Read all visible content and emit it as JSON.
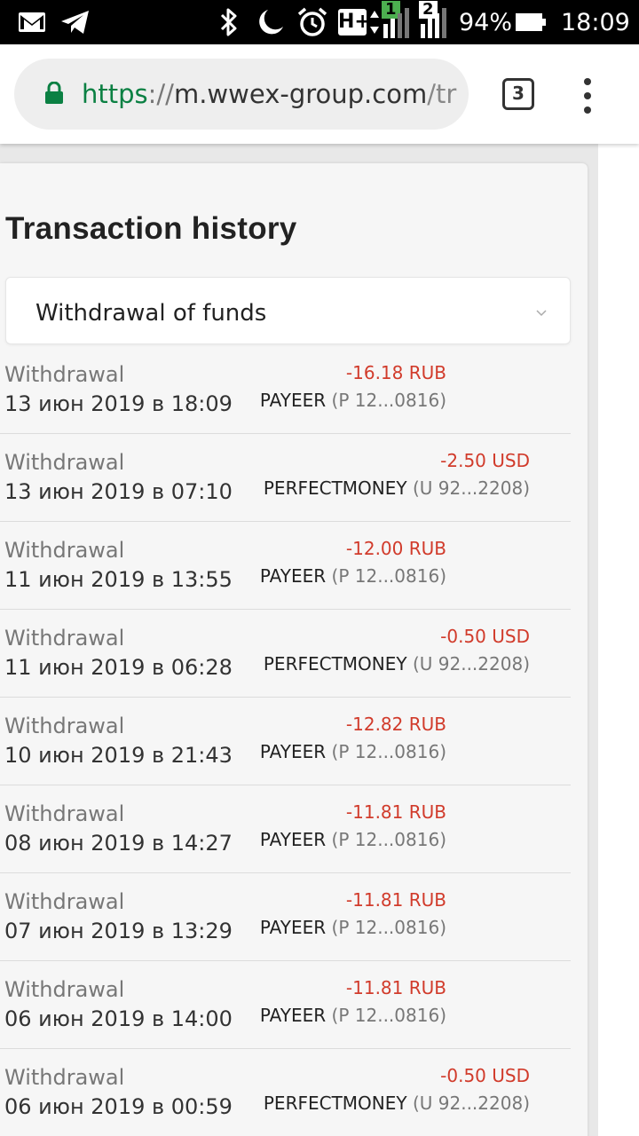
{
  "status_bar": {
    "icons": [
      "gmail-icon",
      "telegram-icon",
      "bluetooth-icon",
      "do-not-disturb-moon-icon",
      "alarm-icon",
      "hplus-network-icon",
      "signal-sim1-icon",
      "signal-sim2-icon",
      "battery-icon"
    ],
    "network_label": "H+",
    "sim1": "1",
    "sim2": "2",
    "battery": "94%",
    "time": "18:09"
  },
  "browser": {
    "url_scheme": "https",
    "url_separator": "://",
    "url_host": "m.wwex-group.com",
    "url_path": "/tr",
    "tab_count": "3",
    "accent_color": "#0b8043"
  },
  "page": {
    "title": "Transaction history",
    "filter_selected": "Withdrawal of funds"
  },
  "transactions": [
    {
      "type": "Withdrawal",
      "date": "13 июн 2019 в 18:09",
      "amount": "-16.18 RUB",
      "system": "PAYEER",
      "account": "(P 12...0816)"
    },
    {
      "type": "Withdrawal",
      "date": "13 июн 2019 в 07:10",
      "amount": "-2.50 USD",
      "system": "PERFECTMONEY",
      "account": "(U 92...2208)"
    },
    {
      "type": "Withdrawal",
      "date": "11 июн 2019 в 13:55",
      "amount": "-12.00 RUB",
      "system": "PAYEER",
      "account": "(P 12...0816)"
    },
    {
      "type": "Withdrawal",
      "date": "11 июн 2019 в 06:28",
      "amount": "-0.50 USD",
      "system": "PERFECTMONEY",
      "account": "(U 92...2208)"
    },
    {
      "type": "Withdrawal",
      "date": "10 июн 2019 в 21:43",
      "amount": "-12.82 RUB",
      "system": "PAYEER",
      "account": "(P 12...0816)"
    },
    {
      "type": "Withdrawal",
      "date": "08 июн 2019 в 14:27",
      "amount": "-11.81 RUB",
      "system": "PAYEER",
      "account": "(P 12...0816)"
    },
    {
      "type": "Withdrawal",
      "date": "07 июн 2019 в 13:29",
      "amount": "-11.81 RUB",
      "system": "PAYEER",
      "account": "(P 12...0816)"
    },
    {
      "type": "Withdrawal",
      "date": "06 июн 2019 в 14:00",
      "amount": "-11.81 RUB",
      "system": "PAYEER",
      "account": "(P 12...0816)"
    },
    {
      "type": "Withdrawal",
      "date": "06 июн 2019 в 00:59",
      "amount": "-0.50 USD",
      "system": "PERFECTMONEY",
      "account": "(U 92...2208)"
    }
  ],
  "colors": {
    "amount_negative": "#d13b2b",
    "status_bar": "#000000",
    "sim1_signal": "#4caf50"
  }
}
